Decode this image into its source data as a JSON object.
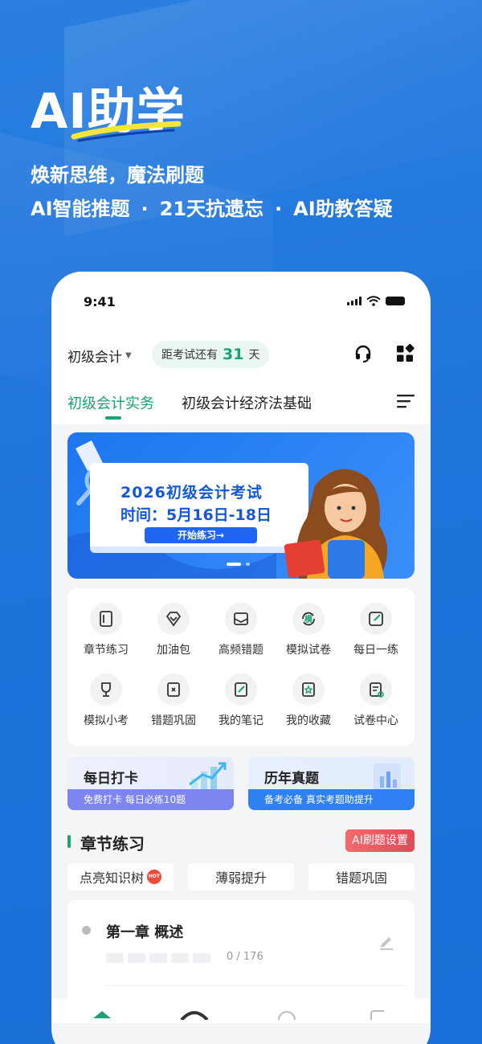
{
  "hero": {
    "title": "AI助学",
    "subtitle": "焕新思维，魔法刷题",
    "features": [
      "AI智能推题",
      "21天抗遗忘",
      "AI助教答疑"
    ],
    "separator": "·"
  },
  "status_bar": {
    "time": "9:41"
  },
  "header": {
    "exam_name": "初级会计",
    "countdown_prefix": "距考试还有",
    "countdown_days": "31",
    "countdown_suffix": "天"
  },
  "subject_tabs": {
    "active": "初级会计实务",
    "other": "初级会计经济法基础"
  },
  "banner": {
    "title": "2026初级会计考试",
    "time_text": "时间：5月16日-18日",
    "button": "开始练习→",
    "slide_index": 1,
    "slide_count": 2
  },
  "quick_actions": [
    {
      "label": "章节练习",
      "icon": "notebook-icon"
    },
    {
      "label": "加油包",
      "icon": "gem-icon"
    },
    {
      "label": "高频错题",
      "icon": "envelope-icon"
    },
    {
      "label": "模拟试卷",
      "icon": "mock-exam-icon"
    },
    {
      "label": "每日一练",
      "icon": "pencil-square-icon"
    },
    {
      "label": "模拟小考",
      "icon": "trophy-icon"
    },
    {
      "label": "错题巩固",
      "icon": "wrong-book-icon"
    },
    {
      "label": "我的笔记",
      "icon": "note-icon"
    },
    {
      "label": "我的收藏",
      "icon": "star-bookmark-icon"
    },
    {
      "label": "试卷中心",
      "icon": "paper-star-icon"
    }
  ],
  "promo_cards": [
    {
      "title": "每日打卡",
      "subtitle": "免费打卡  每日必练10题"
    },
    {
      "title": "历年真题",
      "subtitle": "备考必备  真实考题助提升"
    }
  ],
  "section": {
    "title": "章节练习",
    "ai_button": "AI刷题设置",
    "filters": [
      "点亮知识树",
      "薄弱提升",
      "错题巩固"
    ],
    "hot_badge": "HOT"
  },
  "chapter": {
    "title": "第一章  概述",
    "progress_done": 0,
    "progress_total": 176,
    "progress_text": "0 / 176"
  },
  "colors": {
    "accent": "#1aa276",
    "background": "#1f74dc",
    "ai_button": "#e14a57"
  }
}
